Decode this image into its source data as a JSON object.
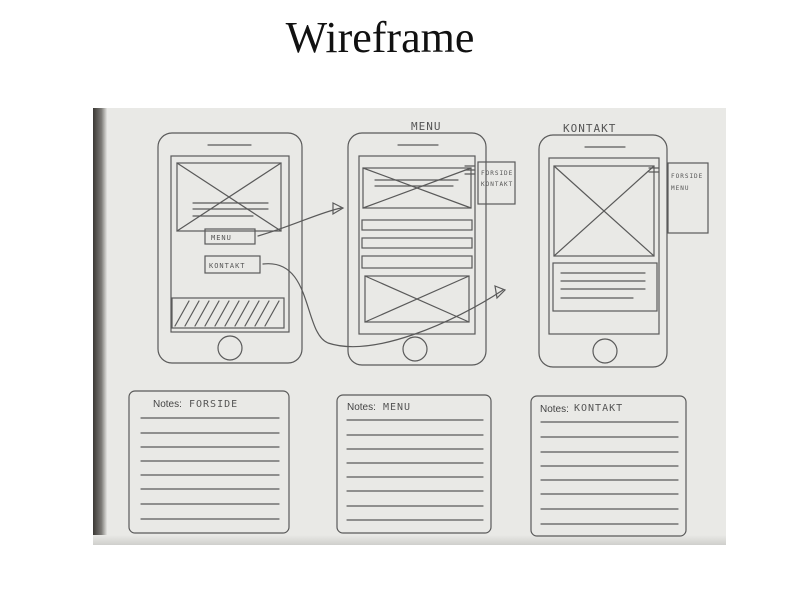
{
  "title": "Wireframe",
  "screens": [
    {
      "heading": "",
      "buttons": [
        "MENU",
        "KONTAKT"
      ],
      "notes_label": "Notes:",
      "notes_value": "FORSIDE"
    },
    {
      "heading": "MENU",
      "side_note": [
        "FORSIDE",
        "KONTAKT"
      ],
      "notes_label": "Notes:",
      "notes_value": "MENU"
    },
    {
      "heading": "KONTAKT",
      "side_note": [
        "FORSIDE",
        "MENU"
      ],
      "notes_label": "Notes:",
      "notes_value": "KONTAKT"
    }
  ],
  "colors": {
    "paper": "#e9e9e6",
    "pencil": "#555555",
    "background": "#ffffff"
  }
}
